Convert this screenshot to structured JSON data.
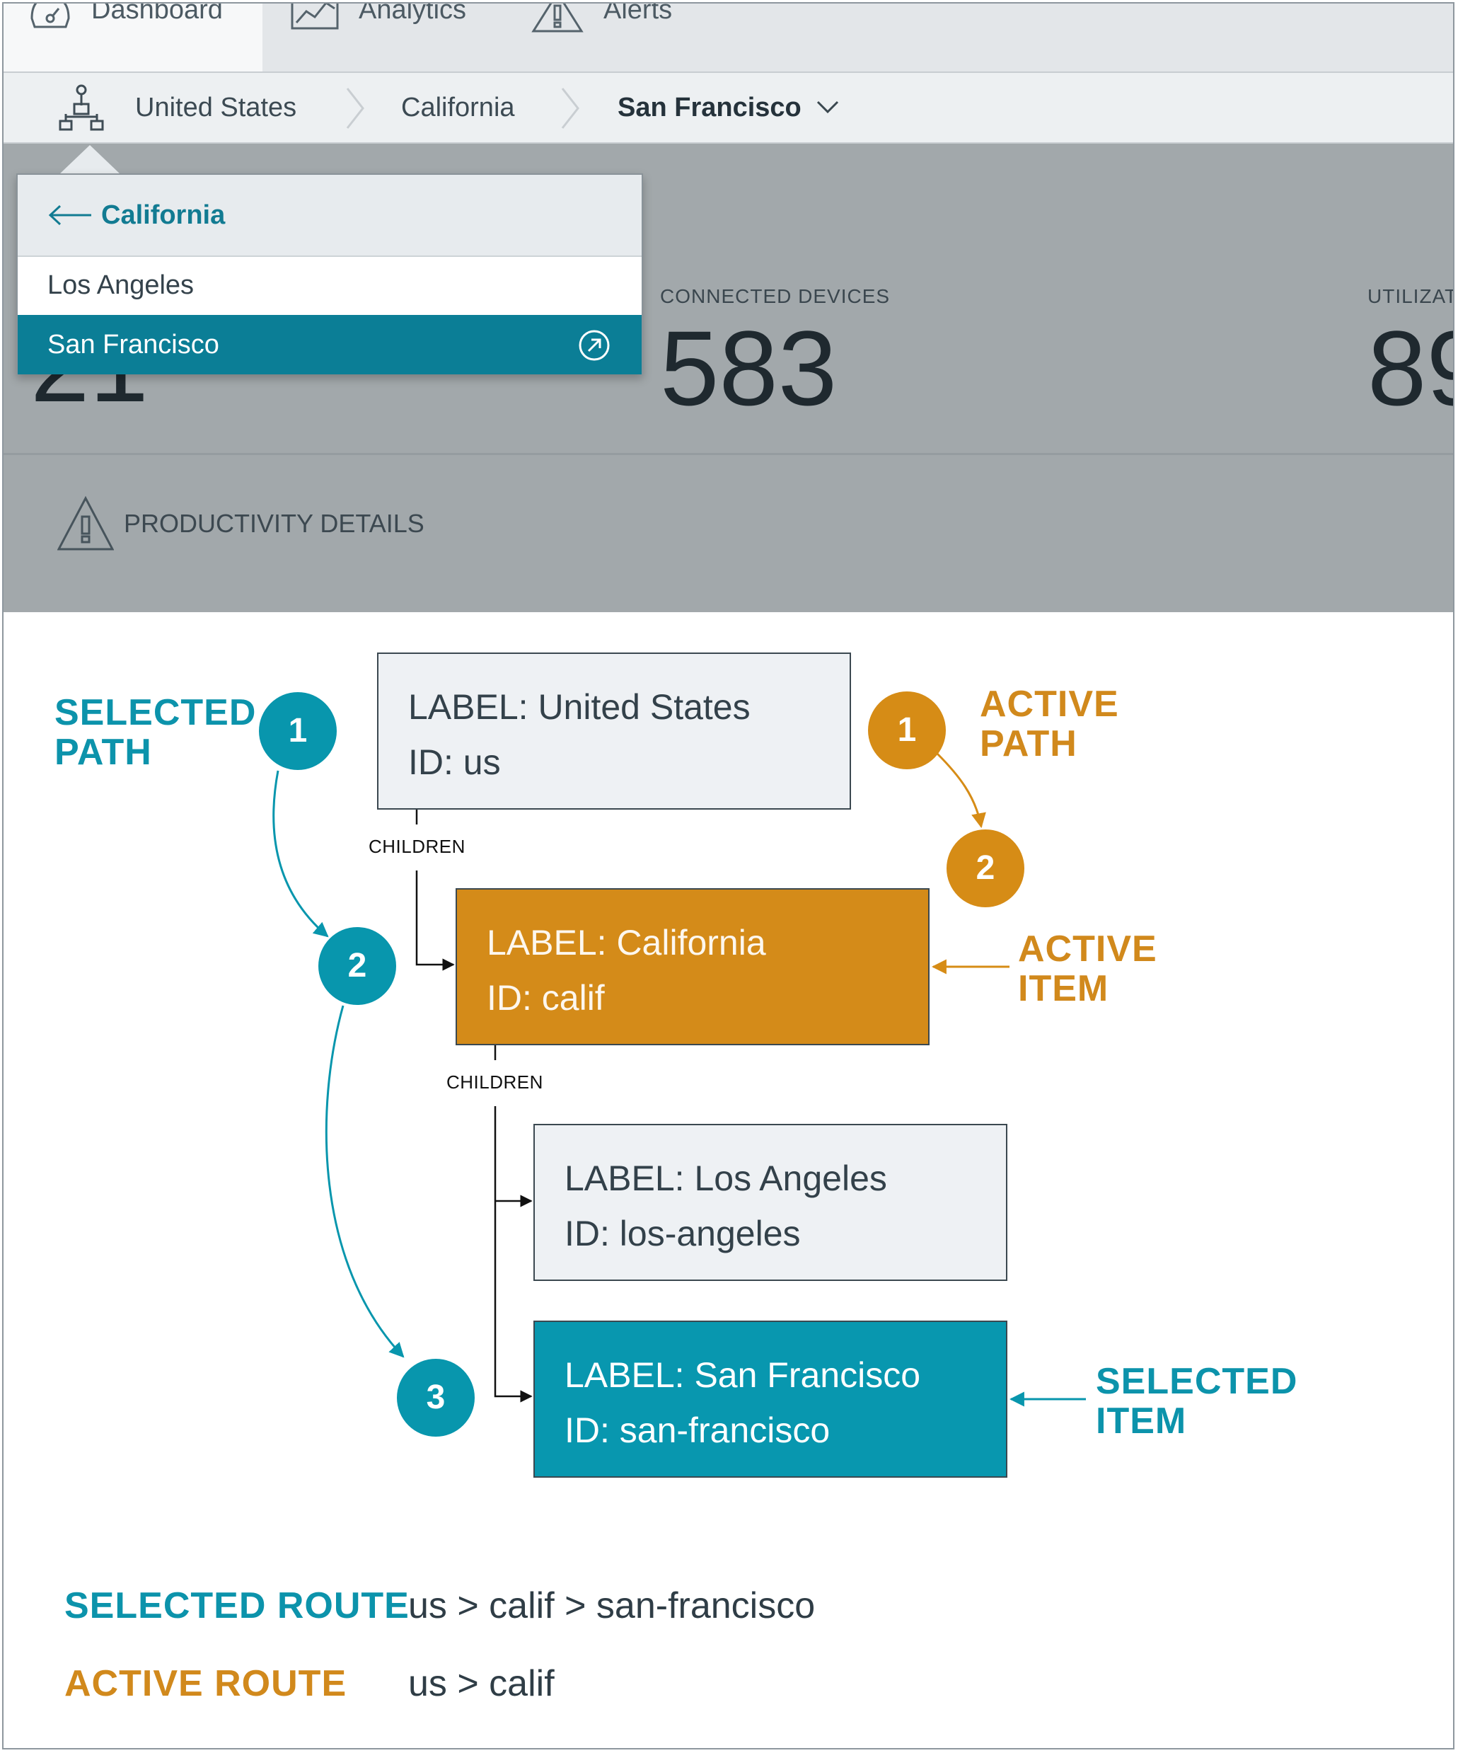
{
  "tabs": [
    {
      "label": "Dashboard",
      "icon": "gauge-icon",
      "active": true
    },
    {
      "label": "Analytics",
      "icon": "chart-icon",
      "active": false
    },
    {
      "label": "Alerts",
      "icon": "alert-icon",
      "active": false
    }
  ],
  "breadcrumb": {
    "icon": "hierarchy-icon",
    "items": [
      "United States",
      "California",
      "San Francisco"
    ],
    "current_index": 2
  },
  "dropdown": {
    "back_label": "California",
    "items": [
      {
        "label": "Los Angeles",
        "selected": false
      },
      {
        "label": "San Francisco",
        "selected": true
      }
    ]
  },
  "stats": [
    {
      "label": "",
      "value": "21"
    },
    {
      "label": "CONNECTED DEVICES",
      "value": "583"
    },
    {
      "label": "UTILIZAT",
      "value": "89"
    }
  ],
  "details_label": "PRODUCTIVITY DETAILS",
  "diagram": {
    "nodes": [
      {
        "label_line": "LABEL: United States",
        "id_line": "ID: us",
        "state": "normal"
      },
      {
        "label_line": "LABEL: California",
        "id_line": "ID: calif",
        "state": "active"
      },
      {
        "label_line": "LABEL: Los Angeles",
        "id_line": "ID: los-angeles",
        "state": "normal"
      },
      {
        "label_line": "LABEL: San Francisco",
        "id_line": "ID: san-francisco",
        "state": "selected"
      }
    ],
    "children_label": "CHILDREN",
    "selected_path": {
      "title_line1": "SELECTED",
      "title_line2": "PATH",
      "steps": [
        "1",
        "2",
        "3"
      ]
    },
    "active_path": {
      "title_line1": "ACTIVE",
      "title_line2": "PATH",
      "steps": [
        "1",
        "2"
      ]
    },
    "active_item": {
      "line1": "ACTIVE",
      "line2": "ITEM"
    },
    "selected_item": {
      "line1": "SELECTED",
      "line2": "ITEM"
    }
  },
  "routes": {
    "selected_label": "SELECTED ROUTE",
    "selected_value": "us > calif > san-francisco",
    "active_label": "ACTIVE ROUTE",
    "active_value": "us > calif"
  },
  "colors": {
    "teal": "#0896ad",
    "gold": "#d68c16",
    "nav_selected": "#0b7e96"
  }
}
